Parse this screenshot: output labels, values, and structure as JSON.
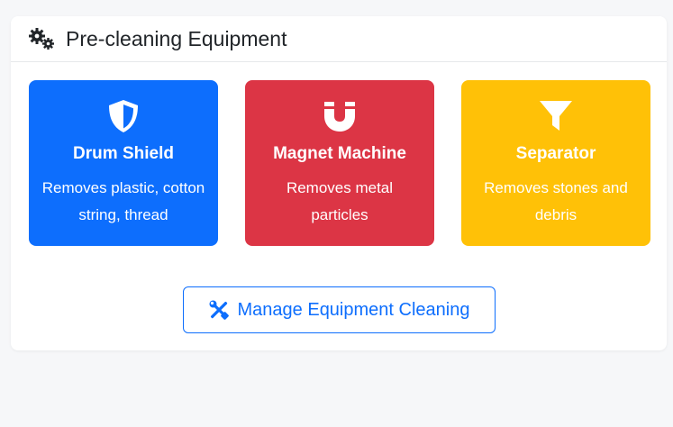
{
  "header": {
    "title": "Pre-cleaning Equipment",
    "icon": "gears-icon"
  },
  "equipment": [
    {
      "title": "Drum Shield",
      "description": "Removes plastic, cotton string, thread",
      "icon": "shield-icon",
      "color": "#0d6efd"
    },
    {
      "title": "Magnet Machine",
      "description": "Removes metal particles",
      "icon": "magnet-icon",
      "color": "#dc3545"
    },
    {
      "title": "Separator",
      "description": "Removes stones and debris",
      "icon": "filter-icon",
      "color": "#ffc107"
    }
  ],
  "action": {
    "label": "Manage Equipment Cleaning",
    "icon": "tools-icon",
    "color": "#0d6efd"
  }
}
